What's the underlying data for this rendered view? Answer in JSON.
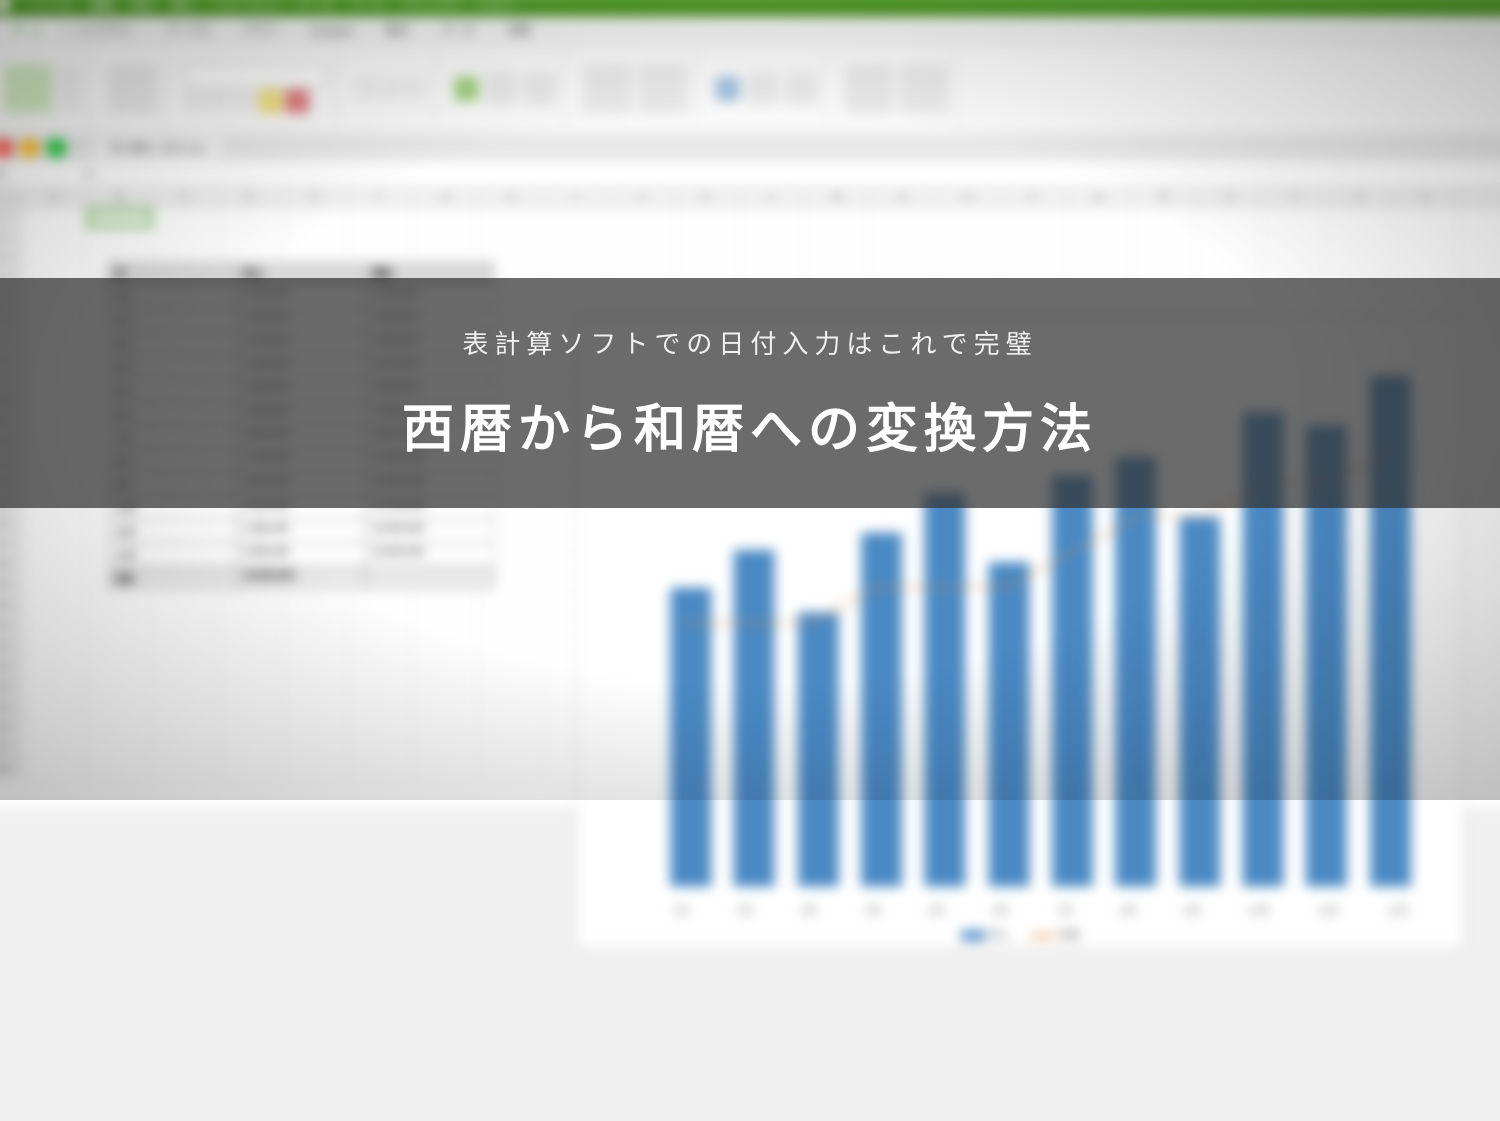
{
  "overlay": {
    "subtitle": "表計算ソフトでの日付入力はこれで完璧",
    "title": "西暦から和暦への変換方法"
  },
  "menubar": {
    "items": [
      "ファイル",
      "編集",
      "表示",
      "挿入",
      "フォーマット",
      "データ",
      "ツール",
      "ウィンドウ",
      "ヘルプ"
    ]
  },
  "ribbon": {
    "tabs": [
      "ホーム",
      "レイアウト",
      "テーブル",
      "グラフ",
      "SmartArt",
      "数式",
      "データ",
      "校閲"
    ],
    "active_tab": "ホーム"
  },
  "document_name": "売上集計_月次.xlsx",
  "cell_ref": "B2",
  "grid": {
    "columns": [
      "A",
      "B",
      "C",
      "D",
      "E",
      "F",
      "G",
      "H",
      "I",
      "J",
      "K",
      "L",
      "M",
      "N",
      "O",
      "P",
      "Q",
      "R",
      "S",
      "T",
      "U",
      "V"
    ],
    "row_count": 28
  },
  "data_table": {
    "headers": [
      "月",
      "売上",
      "累計"
    ],
    "rows": [
      [
        "1月",
        "1,200,000",
        "1,200,000"
      ],
      [
        "2月",
        "1,350,000",
        "2,550,000"
      ],
      [
        "3月",
        "1,100,000",
        "3,650,000"
      ],
      [
        "4月",
        "1,420,000",
        "5,070,000"
      ],
      [
        "5月",
        "1,580,000",
        "6,650,000"
      ],
      [
        "6月",
        "1,300,000",
        "7,950,000"
      ],
      [
        "7月",
        "1,650,000",
        "9,600,000"
      ],
      [
        "8月",
        "1,720,000",
        "11,320,000"
      ],
      [
        "9月",
        "1,480,000",
        "12,800,000"
      ],
      [
        "10月",
        "1,900,000",
        "14,700,000"
      ],
      [
        "11月",
        "1,850,000",
        "16,550,000"
      ],
      [
        "12月",
        "2,050,000",
        "18,600,000"
      ]
    ],
    "footer": [
      "合計",
      "18,600,000",
      ""
    ]
  },
  "chart_data": {
    "type": "bar",
    "title": "",
    "categories": [
      "1月",
      "2月",
      "3月",
      "4月",
      "5月",
      "6月",
      "7月",
      "8月",
      "9月",
      "10月",
      "11月",
      "12月"
    ],
    "series": [
      {
        "name": "売上",
        "type": "bar",
        "values": [
          1200000,
          1350000,
          1100000,
          1420000,
          1580000,
          1300000,
          1650000,
          1720000,
          1480000,
          1900000,
          1850000,
          2050000
        ]
      },
      {
        "name": "目標",
        "type": "line",
        "values": [
          1400000,
          1400000,
          1400000,
          1500000,
          1500000,
          1500000,
          1600000,
          1700000,
          1700000,
          1800000,
          1800000,
          1900000
        ]
      }
    ],
    "ylim": [
      0,
      2200000
    ],
    "xlabel": "",
    "ylabel": ""
  },
  "colors": {
    "bar": "#4a89c4",
    "line": "#e08b3a",
    "accent": "#3ba020"
  }
}
